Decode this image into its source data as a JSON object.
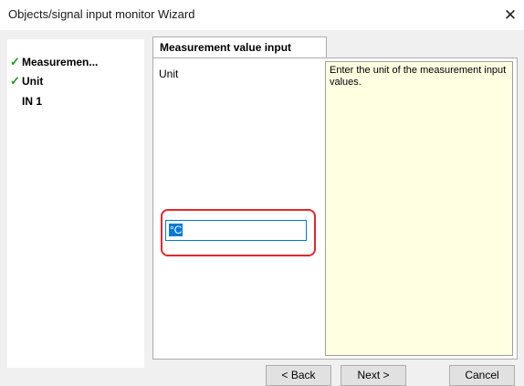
{
  "window": {
    "title": "Objects/signal input monitor Wizard",
    "close_glyph": "✕"
  },
  "nav": {
    "items": [
      {
        "label": "Measuremen...",
        "checked": true,
        "check_glyph": "✓"
      },
      {
        "label": "Unit",
        "checked": true,
        "check_glyph": "✓"
      },
      {
        "label": "IN 1",
        "checked": false
      }
    ]
  },
  "tab": {
    "label": "Measurement value input"
  },
  "form": {
    "unit_label": "Unit",
    "unit_value": "°C"
  },
  "help": {
    "text": "Enter the unit of the measurement input values."
  },
  "buttons": {
    "back": "< Back",
    "next": "Next >",
    "cancel": "Cancel"
  },
  "colors": {
    "check": "#1f9a1f",
    "highlight": "#e0282e",
    "help_bg": "#ffffe1",
    "selection": "#0078d7"
  }
}
